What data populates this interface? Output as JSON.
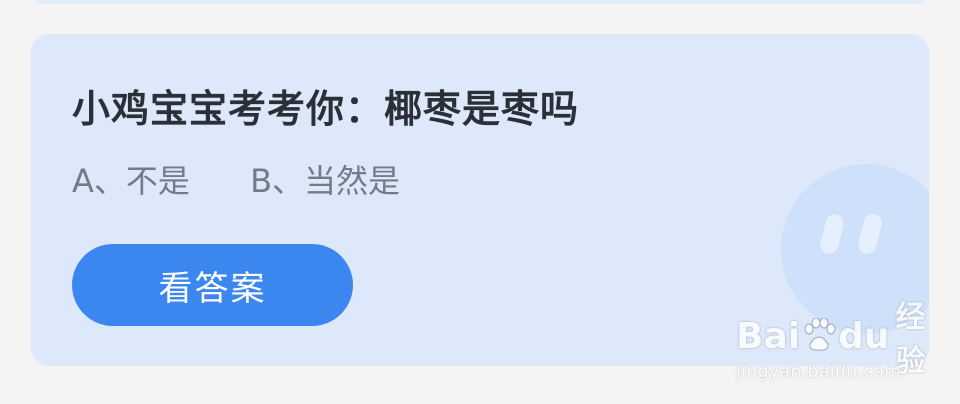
{
  "quiz": {
    "question": "小鸡宝宝考考你：椰枣是枣吗",
    "option_a": "A、不是",
    "option_b": "B、当然是",
    "answer_button_label": "看答案"
  },
  "watermark": {
    "brand_part1": "Bai",
    "brand_part2": "du",
    "brand_suffix": "经验",
    "url": "jingyan.baidu.com"
  },
  "colors": {
    "page_background": "#f4f4f5",
    "card_background": "#dde9fb",
    "button_background": "#3c87ef",
    "question_text": "#2a2f38",
    "option_text": "#747b86"
  },
  "icons": {
    "mascot": "chick-mascot-icon",
    "paw": "baidu-paw-icon"
  }
}
